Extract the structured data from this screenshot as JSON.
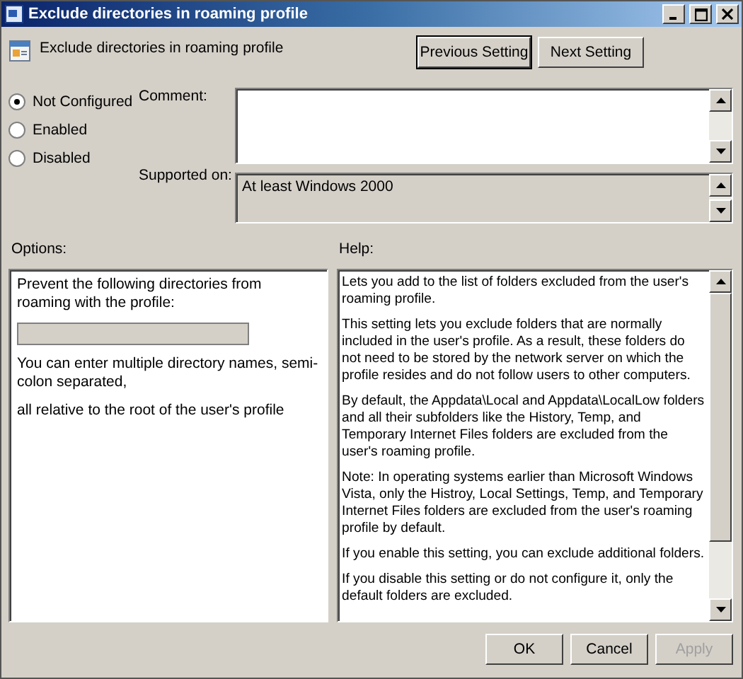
{
  "window": {
    "title": "Exclude directories in roaming profile"
  },
  "header": {
    "setting_name": "Exclude directories in roaming profile",
    "buttons": [
      {
        "label": "Previous Setting",
        "focused": true
      },
      {
        "label": "Next Setting",
        "focused": false
      }
    ]
  },
  "state_options": [
    {
      "label": "Not Configured",
      "selected": true
    },
    {
      "label": "Enabled",
      "selected": false
    },
    {
      "label": "Disabled",
      "selected": false
    }
  ],
  "comment": {
    "label": "Comment:"
  },
  "supported_on": {
    "label": "Supported on:",
    "value": "At least Windows 2000"
  },
  "options": {
    "label": "Options:",
    "prompt": "Prevent the following directories from roaming with the profile:",
    "field_disabled": true,
    "notes": [
      "You can enter multiple directory names, semi-colon separated,",
      "all relative to the root of the user's profile"
    ]
  },
  "help": {
    "label": "Help:",
    "paragraphs": [
      "Lets you add to the list of folders excluded from the user's roaming profile.",
      "This setting lets you exclude folders that are normally included in the user's profile. As a result, these folders do not need to be stored by the network server on which the profile resides and do not follow users to other computers.",
      "By default, the Appdata\\Local and Appdata\\LocalLow folders and all their subfolders like the History, Temp, and Temporary Internet Files folders are excluded from the user's roaming profile.",
      "Note: In operating systems earlier than Microsoft Windows Vista, only the Histroy, Local Settings, Temp, and Temporary Internet Files folders are excluded from the user's roaming profile by default.",
      "If you enable this setting, you can exclude additional folders.",
      "If you disable this setting or do not configure it, only the default folders are excluded."
    ]
  },
  "footer_buttons": [
    {
      "label": "OK",
      "disabled": false
    },
    {
      "label": "Cancel",
      "disabled": false
    },
    {
      "label": "Apply",
      "disabled": true
    }
  ]
}
